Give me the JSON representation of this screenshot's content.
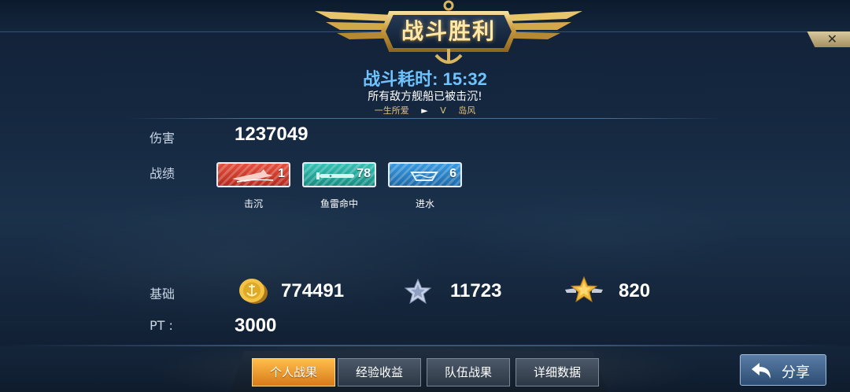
{
  "header": {
    "title": "战斗胜利",
    "close_symbol": "✕"
  },
  "summary": {
    "duration_label": "战斗耗时:",
    "duration_value": "15:32",
    "message": "所有敌方舰船已被击沉!",
    "mvp_player": "一生所爱",
    "mvp_arrow": "►",
    "mvp_rank": "V",
    "mvp_ship": "岛风"
  },
  "stats": {
    "damage_label": "伤害",
    "damage_value": "1237049",
    "record_label": "战绩",
    "medals": [
      {
        "caption": "击沉",
        "count": "1",
        "color": "#d63a2c",
        "icon": "sinking-ship-icon"
      },
      {
        "caption": "鱼雷命中",
        "count": "78",
        "color": "#1fa89c",
        "icon": "torpedo-icon"
      },
      {
        "caption": "进水",
        "count": "6",
        "color": "#2a86c9",
        "icon": "flooding-icon"
      }
    ],
    "base_label": "基础",
    "gold_value": "774491",
    "silver_star_value": "11723",
    "gold_star_value": "820",
    "pt_label": "PT :",
    "pt_value": "3000"
  },
  "tabs": [
    {
      "label": "个人战果",
      "active": true
    },
    {
      "label": "经验收益",
      "active": false
    },
    {
      "label": "队伍战果",
      "active": false
    },
    {
      "label": "详细数据",
      "active": false
    }
  ],
  "share": {
    "label": "分享",
    "icon": "return-arrow-icon"
  },
  "colors": {
    "accent_blue": "#6fc3ff",
    "gold": "#e2c27a",
    "active_tab": "#ffbe4a"
  }
}
